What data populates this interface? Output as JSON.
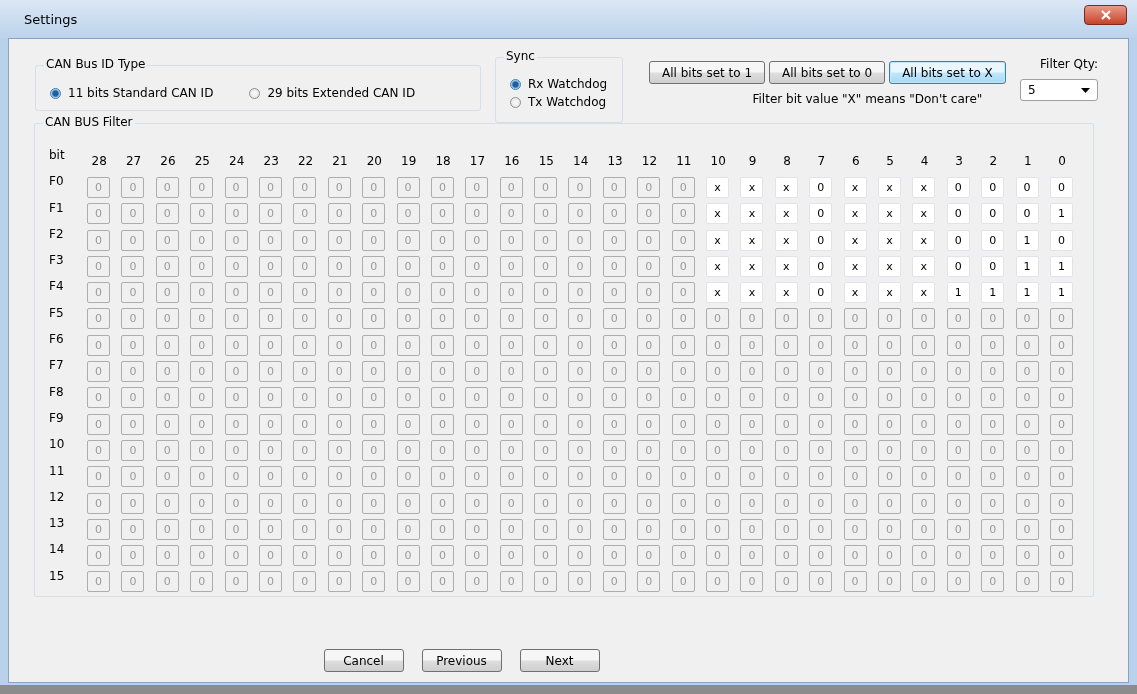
{
  "window": {
    "title": "Settings"
  },
  "id_type": {
    "legend": "CAN Bus ID Type",
    "options": [
      {
        "label": "11 bits Standard CAN ID",
        "selected": true
      },
      {
        "label": "29 bits Extended CAN ID",
        "selected": false
      }
    ]
  },
  "sync": {
    "legend": "Sync",
    "options": [
      {
        "label": "Rx Watchdog",
        "selected": true
      },
      {
        "label": "Tx Watchdog",
        "selected": false
      }
    ]
  },
  "bit_buttons": [
    {
      "label": "All bits set to 1",
      "focused": false
    },
    {
      "label": "All bits set to 0",
      "focused": false
    },
    {
      "label": "All bits set to X",
      "focused": true
    }
  ],
  "note": "Filter bit value \"X\" means \"Don't care\"",
  "filter_qty": {
    "label": "Filter Qty:",
    "value": "5"
  },
  "filter": {
    "legend": "CAN BUS Filter",
    "corner": "bit",
    "columns": [
      "28",
      "27",
      "26",
      "25",
      "24",
      "23",
      "22",
      "21",
      "20",
      "19",
      "18",
      "17",
      "16",
      "15",
      "14",
      "13",
      "12",
      "11",
      "10",
      "9",
      "8",
      "7",
      "6",
      "5",
      "4",
      "3",
      "2",
      "1",
      "0"
    ],
    "rows": [
      {
        "label": "F0",
        "values": [
          "0",
          "0",
          "0",
          "0",
          "0",
          "0",
          "0",
          "0",
          "0",
          "0",
          "0",
          "0",
          "0",
          "0",
          "0",
          "0",
          "0",
          "0",
          "x",
          "x",
          "x",
          "0",
          "x",
          "x",
          "x",
          "0",
          "0",
          "0",
          "0"
        ],
        "editable": [
          false,
          false,
          false,
          false,
          false,
          false,
          false,
          false,
          false,
          false,
          false,
          false,
          false,
          false,
          false,
          false,
          false,
          false,
          true,
          true,
          true,
          true,
          true,
          true,
          true,
          true,
          true,
          true,
          true
        ]
      },
      {
        "label": "F1",
        "values": [
          "0",
          "0",
          "0",
          "0",
          "0",
          "0",
          "0",
          "0",
          "0",
          "0",
          "0",
          "0",
          "0",
          "0",
          "0",
          "0",
          "0",
          "0",
          "x",
          "x",
          "x",
          "0",
          "x",
          "x",
          "x",
          "0",
          "0",
          "0",
          "1"
        ],
        "editable": [
          false,
          false,
          false,
          false,
          false,
          false,
          false,
          false,
          false,
          false,
          false,
          false,
          false,
          false,
          false,
          false,
          false,
          false,
          true,
          true,
          true,
          true,
          true,
          true,
          true,
          true,
          true,
          true,
          true
        ]
      },
      {
        "label": "F2",
        "values": [
          "0",
          "0",
          "0",
          "0",
          "0",
          "0",
          "0",
          "0",
          "0",
          "0",
          "0",
          "0",
          "0",
          "0",
          "0",
          "0",
          "0",
          "0",
          "x",
          "x",
          "x",
          "0",
          "x",
          "x",
          "x",
          "0",
          "0",
          "1",
          "0"
        ],
        "editable": [
          false,
          false,
          false,
          false,
          false,
          false,
          false,
          false,
          false,
          false,
          false,
          false,
          false,
          false,
          false,
          false,
          false,
          false,
          true,
          true,
          true,
          true,
          true,
          true,
          true,
          true,
          true,
          true,
          true
        ]
      },
      {
        "label": "F3",
        "values": [
          "0",
          "0",
          "0",
          "0",
          "0",
          "0",
          "0",
          "0",
          "0",
          "0",
          "0",
          "0",
          "0",
          "0",
          "0",
          "0",
          "0",
          "0",
          "x",
          "x",
          "x",
          "0",
          "x",
          "x",
          "x",
          "0",
          "0",
          "1",
          "1"
        ],
        "editable": [
          false,
          false,
          false,
          false,
          false,
          false,
          false,
          false,
          false,
          false,
          false,
          false,
          false,
          false,
          false,
          false,
          false,
          false,
          true,
          true,
          true,
          true,
          true,
          true,
          true,
          true,
          true,
          true,
          true
        ]
      },
      {
        "label": "F4",
        "values": [
          "0",
          "0",
          "0",
          "0",
          "0",
          "0",
          "0",
          "0",
          "0",
          "0",
          "0",
          "0",
          "0",
          "0",
          "0",
          "0",
          "0",
          "0",
          "x",
          "x",
          "x",
          "0",
          "x",
          "x",
          "x",
          "1",
          "1",
          "1",
          "1"
        ],
        "editable": [
          false,
          false,
          false,
          false,
          false,
          false,
          false,
          false,
          false,
          false,
          false,
          false,
          false,
          false,
          false,
          false,
          false,
          false,
          true,
          true,
          true,
          true,
          true,
          true,
          true,
          true,
          true,
          true,
          true
        ]
      },
      {
        "label": "F5",
        "values": [
          "0",
          "0",
          "0",
          "0",
          "0",
          "0",
          "0",
          "0",
          "0",
          "0",
          "0",
          "0",
          "0",
          "0",
          "0",
          "0",
          "0",
          "0",
          "0",
          "0",
          "0",
          "0",
          "0",
          "0",
          "0",
          "0",
          "0",
          "0",
          "0"
        ],
        "editable": [
          false,
          false,
          false,
          false,
          false,
          false,
          false,
          false,
          false,
          false,
          false,
          false,
          false,
          false,
          false,
          false,
          false,
          false,
          false,
          false,
          false,
          false,
          false,
          false,
          false,
          false,
          false,
          false,
          false
        ]
      },
      {
        "label": "F6",
        "values": [
          "0",
          "0",
          "0",
          "0",
          "0",
          "0",
          "0",
          "0",
          "0",
          "0",
          "0",
          "0",
          "0",
          "0",
          "0",
          "0",
          "0",
          "0",
          "0",
          "0",
          "0",
          "0",
          "0",
          "0",
          "0",
          "0",
          "0",
          "0",
          "0"
        ],
        "editable": [
          false,
          false,
          false,
          false,
          false,
          false,
          false,
          false,
          false,
          false,
          false,
          false,
          false,
          false,
          false,
          false,
          false,
          false,
          false,
          false,
          false,
          false,
          false,
          false,
          false,
          false,
          false,
          false,
          false
        ]
      },
      {
        "label": "F7",
        "values": [
          "0",
          "0",
          "0",
          "0",
          "0",
          "0",
          "0",
          "0",
          "0",
          "0",
          "0",
          "0",
          "0",
          "0",
          "0",
          "0",
          "0",
          "0",
          "0",
          "0",
          "0",
          "0",
          "0",
          "0",
          "0",
          "0",
          "0",
          "0",
          "0"
        ],
        "editable": [
          false,
          false,
          false,
          false,
          false,
          false,
          false,
          false,
          false,
          false,
          false,
          false,
          false,
          false,
          false,
          false,
          false,
          false,
          false,
          false,
          false,
          false,
          false,
          false,
          false,
          false,
          false,
          false,
          false
        ]
      },
      {
        "label": "F8",
        "values": [
          "0",
          "0",
          "0",
          "0",
          "0",
          "0",
          "0",
          "0",
          "0",
          "0",
          "0",
          "0",
          "0",
          "0",
          "0",
          "0",
          "0",
          "0",
          "0",
          "0",
          "0",
          "0",
          "0",
          "0",
          "0",
          "0",
          "0",
          "0",
          "0"
        ],
        "editable": [
          false,
          false,
          false,
          false,
          false,
          false,
          false,
          false,
          false,
          false,
          false,
          false,
          false,
          false,
          false,
          false,
          false,
          false,
          false,
          false,
          false,
          false,
          false,
          false,
          false,
          false,
          false,
          false,
          false
        ]
      },
      {
        "label": "F9",
        "values": [
          "0",
          "0",
          "0",
          "0",
          "0",
          "0",
          "0",
          "0",
          "0",
          "0",
          "0",
          "0",
          "0",
          "0",
          "0",
          "0",
          "0",
          "0",
          "0",
          "0",
          "0",
          "0",
          "0",
          "0",
          "0",
          "0",
          "0",
          "0",
          "0"
        ],
        "editable": [
          false,
          false,
          false,
          false,
          false,
          false,
          false,
          false,
          false,
          false,
          false,
          false,
          false,
          false,
          false,
          false,
          false,
          false,
          false,
          false,
          false,
          false,
          false,
          false,
          false,
          false,
          false,
          false,
          false
        ]
      },
      {
        "label": "10",
        "values": [
          "0",
          "0",
          "0",
          "0",
          "0",
          "0",
          "0",
          "0",
          "0",
          "0",
          "0",
          "0",
          "0",
          "0",
          "0",
          "0",
          "0",
          "0",
          "0",
          "0",
          "0",
          "0",
          "0",
          "0",
          "0",
          "0",
          "0",
          "0",
          "0"
        ],
        "editable": [
          false,
          false,
          false,
          false,
          false,
          false,
          false,
          false,
          false,
          false,
          false,
          false,
          false,
          false,
          false,
          false,
          false,
          false,
          false,
          false,
          false,
          false,
          false,
          false,
          false,
          false,
          false,
          false,
          false
        ]
      },
      {
        "label": "11",
        "values": [
          "0",
          "0",
          "0",
          "0",
          "0",
          "0",
          "0",
          "0",
          "0",
          "0",
          "0",
          "0",
          "0",
          "0",
          "0",
          "0",
          "0",
          "0",
          "0",
          "0",
          "0",
          "0",
          "0",
          "0",
          "0",
          "0",
          "0",
          "0",
          "0"
        ],
        "editable": [
          false,
          false,
          false,
          false,
          false,
          false,
          false,
          false,
          false,
          false,
          false,
          false,
          false,
          false,
          false,
          false,
          false,
          false,
          false,
          false,
          false,
          false,
          false,
          false,
          false,
          false,
          false,
          false,
          false
        ]
      },
      {
        "label": "12",
        "values": [
          "0",
          "0",
          "0",
          "0",
          "0",
          "0",
          "0",
          "0",
          "0",
          "0",
          "0",
          "0",
          "0",
          "0",
          "0",
          "0",
          "0",
          "0",
          "0",
          "0",
          "0",
          "0",
          "0",
          "0",
          "0",
          "0",
          "0",
          "0",
          "0"
        ],
        "editable": [
          false,
          false,
          false,
          false,
          false,
          false,
          false,
          false,
          false,
          false,
          false,
          false,
          false,
          false,
          false,
          false,
          false,
          false,
          false,
          false,
          false,
          false,
          false,
          false,
          false,
          false,
          false,
          false,
          false
        ]
      },
      {
        "label": "13",
        "values": [
          "0",
          "0",
          "0",
          "0",
          "0",
          "0",
          "0",
          "0",
          "0",
          "0",
          "0",
          "0",
          "0",
          "0",
          "0",
          "0",
          "0",
          "0",
          "0",
          "0",
          "0",
          "0",
          "0",
          "0",
          "0",
          "0",
          "0",
          "0",
          "0"
        ],
        "editable": [
          false,
          false,
          false,
          false,
          false,
          false,
          false,
          false,
          false,
          false,
          false,
          false,
          false,
          false,
          false,
          false,
          false,
          false,
          false,
          false,
          false,
          false,
          false,
          false,
          false,
          false,
          false,
          false,
          false
        ]
      },
      {
        "label": "14",
        "values": [
          "0",
          "0",
          "0",
          "0",
          "0",
          "0",
          "0",
          "0",
          "0",
          "0",
          "0",
          "0",
          "0",
          "0",
          "0",
          "0",
          "0",
          "0",
          "0",
          "0",
          "0",
          "0",
          "0",
          "0",
          "0",
          "0",
          "0",
          "0",
          "0"
        ],
        "editable": [
          false,
          false,
          false,
          false,
          false,
          false,
          false,
          false,
          false,
          false,
          false,
          false,
          false,
          false,
          false,
          false,
          false,
          false,
          false,
          false,
          false,
          false,
          false,
          false,
          false,
          false,
          false,
          false,
          false
        ]
      },
      {
        "label": "15",
        "values": [
          "0",
          "0",
          "0",
          "0",
          "0",
          "0",
          "0",
          "0",
          "0",
          "0",
          "0",
          "0",
          "0",
          "0",
          "0",
          "0",
          "0",
          "0",
          "0",
          "0",
          "0",
          "0",
          "0",
          "0",
          "0",
          "0",
          "0",
          "0",
          "0"
        ],
        "editable": [
          false,
          false,
          false,
          false,
          false,
          false,
          false,
          false,
          false,
          false,
          false,
          false,
          false,
          false,
          false,
          false,
          false,
          false,
          false,
          false,
          false,
          false,
          false,
          false,
          false,
          false,
          false,
          false,
          false
        ]
      }
    ]
  },
  "footer_buttons": [
    "Cancel",
    "Previous",
    "Next"
  ]
}
